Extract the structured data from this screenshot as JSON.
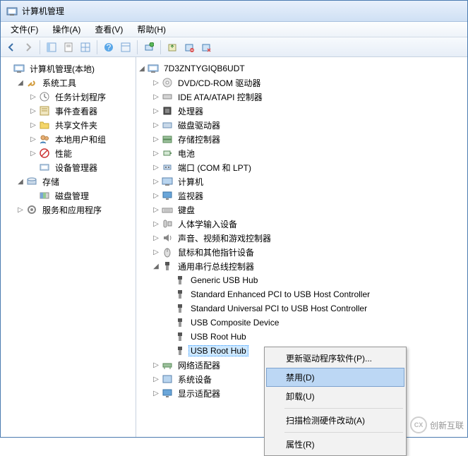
{
  "window": {
    "title": "计算机管理"
  },
  "menubar": {
    "file": "文件(F)",
    "action": "操作(A)",
    "view": "查看(V)",
    "help": "帮助(H)"
  },
  "left_tree": {
    "root": "计算机管理(本地)",
    "system_tools": "系统工具",
    "task_scheduler": "任务计划程序",
    "event_viewer": "事件查看器",
    "shared_folders": "共享文件夹",
    "local_users": "本地用户和组",
    "performance": "性能",
    "device_manager": "设备管理器",
    "storage": "存储",
    "disk_mgmt": "磁盘管理",
    "services": "服务和应用程序"
  },
  "right_tree": {
    "computer": "7D3ZNTYGIQB6UDT",
    "dvd": "DVD/CD-ROM 驱动器",
    "ide": "IDE ATA/ATAPI 控制器",
    "processor": "处理器",
    "disk_drives": "磁盘驱动器",
    "storage_ctrl": "存储控制器",
    "battery": "电池",
    "ports": "端口 (COM 和 LPT)",
    "computer_cat": "计算机",
    "monitor": "监视器",
    "keyboard": "键盘",
    "hid": "人体学输入设备",
    "sound": "声音、视频和游戏控制器",
    "mouse": "鼠标和其他指针设备",
    "usb_ctrl": "通用串行总线控制器",
    "usb_generic": "Generic USB Hub",
    "usb_std_enh": "Standard Enhanced PCI to USB Host Controller",
    "usb_std_uni": "Standard Universal PCI to USB Host Controller",
    "usb_composite": "USB Composite Device",
    "usb_root1": "USB Root Hub",
    "usb_root2": "USB Root Hub",
    "network": "网络适配器",
    "system_devices": "系统设备",
    "display": "显示适配器"
  },
  "context_menu": {
    "update_driver": "更新驱动程序软件(P)...",
    "disable": "禁用(D)",
    "uninstall": "卸载(U)",
    "scan_hw": "扫描检测硬件改动(A)",
    "properties": "属性(R)"
  },
  "watermark": "创新互联"
}
